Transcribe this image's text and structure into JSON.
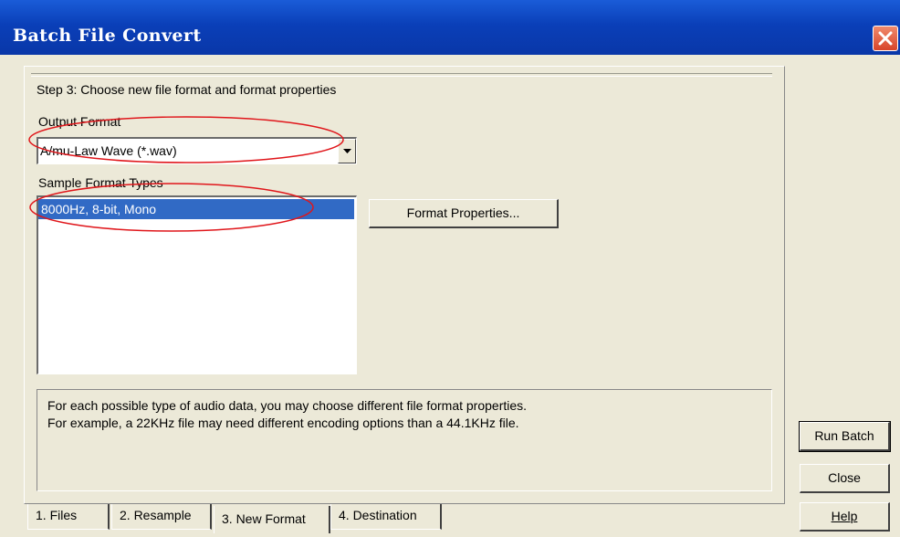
{
  "window": {
    "title": "Batch File Convert",
    "close_icon": "close-icon"
  },
  "step": {
    "label": "Step 3:  Choose new file format and format properties"
  },
  "output_format": {
    "label": "Output Format",
    "value": "A/mu-Law Wave (*.wav)"
  },
  "sample_formats": {
    "label": "Sample Format Types",
    "items": [
      "8000Hz, 8-bit, Mono"
    ]
  },
  "format_properties_button": "Format Properties...",
  "info": {
    "line1": "For each possible type of audio data, you may choose different file format properties.",
    "line2": "For example, a 22KHz file may need different encoding options than a 44.1KHz file."
  },
  "buttons": {
    "run_batch": "Run Batch",
    "close": "Close",
    "help": "Help"
  },
  "tabs": [
    "1. Files",
    "2. Resample",
    "3. New Format",
    "4. Destination"
  ],
  "colors": {
    "title_bar": "#0a3fb8",
    "selection": "#316ac5",
    "annotation": "#e0161b",
    "dialog_bg": "#ece9d8"
  }
}
